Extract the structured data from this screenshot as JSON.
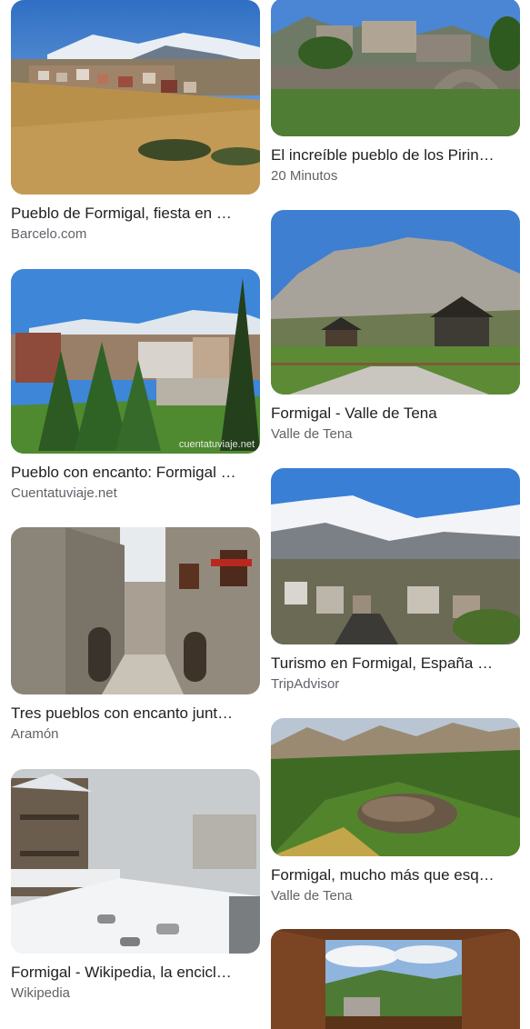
{
  "results": {
    "left": [
      {
        "title": "Pueblo de Formigal, fiesta en …",
        "source": "Barcelo.com"
      },
      {
        "title": "Pueblo con encanto: Formigal …",
        "source": "Cuentatuviaje.net",
        "watermark": "cuentatuviaje.net"
      },
      {
        "title": "Tres pueblos con encanto junt…",
        "source": "Aramón"
      },
      {
        "title": "Formigal - Wikipedia, la encicl…",
        "source": "Wikipedia"
      }
    ],
    "right": [
      {
        "title": "El increíble pueblo de los Pirin…",
        "source": "20 Minutos"
      },
      {
        "title": "Formigal - Valle de Tena",
        "source": "Valle de Tena"
      },
      {
        "title": "Turismo en Formigal, España …",
        "source": "TripAdvisor"
      },
      {
        "title": "Formigal, mucho más que esq…",
        "source": "Valle de Tena"
      },
      {
        "title": "",
        "source": ""
      }
    ]
  }
}
